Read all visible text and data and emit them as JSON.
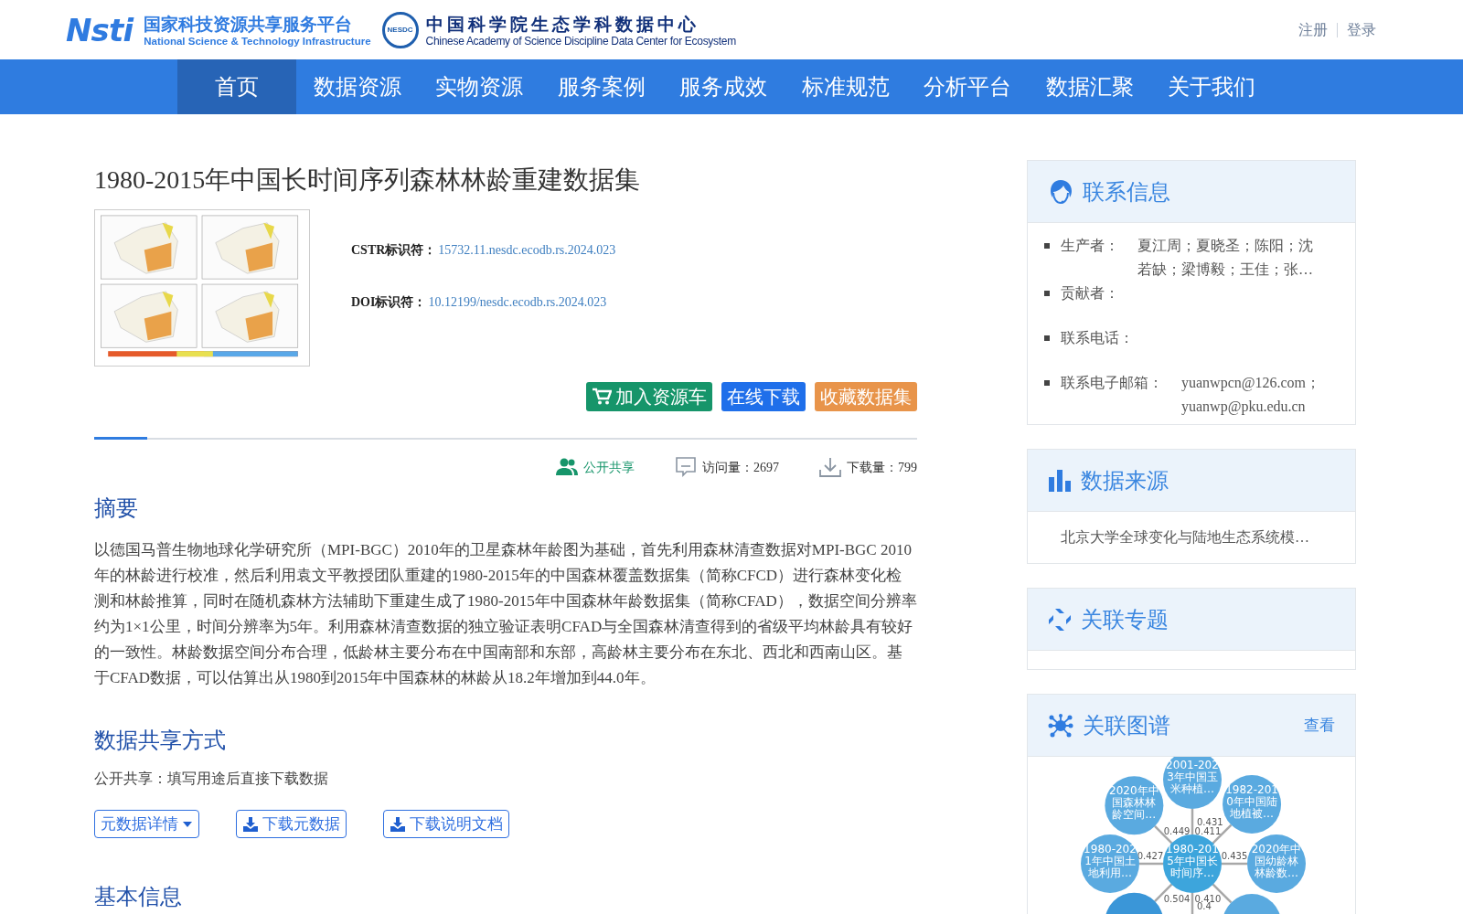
{
  "header": {
    "platform_mark": "Nsti",
    "platform_name": "国家科技资源共享服务平台",
    "platform_name_en": "National Science & Technology Infrastructure",
    "center_mark": "NESDC",
    "center_name": "中国科学院生态学科数据中心",
    "center_name_en": "Chinese Academy of Science Discipline Data Center for Ecosystem",
    "account_links": [
      "注册",
      "登录"
    ]
  },
  "nav": [
    {
      "label": "首页",
      "selected": true
    },
    {
      "label": "数据资源",
      "selected": false
    },
    {
      "label": "实物资源",
      "selected": false
    },
    {
      "label": "服务案例",
      "selected": false
    },
    {
      "label": "服务成效",
      "selected": false
    },
    {
      "label": "标准规范",
      "selected": false
    },
    {
      "label": "分析平台",
      "selected": false
    },
    {
      "label": "数据汇聚",
      "selected": false
    },
    {
      "label": "关于我们",
      "selected": false
    }
  ],
  "dataset": {
    "title": "1980-2015年中国长时间序列森林林龄重建数据集",
    "identifiers": [
      {
        "label": "CSTR标识符：",
        "value": "15732.11.nesdc.ecodb.rs.2024.023"
      },
      {
        "label": "DOI标识符：",
        "value": "10.12199/nesdc.ecodb.rs.2024.023"
      }
    ],
    "actions": [
      {
        "label": "加入资源车",
        "kind": "cart"
      },
      {
        "label": "在线下载",
        "kind": "download"
      },
      {
        "label": "收藏数据集",
        "kind": "favorite"
      }
    ],
    "stats": [
      {
        "kind": "share",
        "label": "公开共享"
      },
      {
        "kind": "visits",
        "label": "访问量：",
        "value": "2697"
      },
      {
        "kind": "downloads",
        "label": "下载量：",
        "value": "799"
      }
    ],
    "abstract": {
      "heading": "摘要",
      "text": "以德国马普生物地球化学研究所（MPI-BGC）2010年的卫星森林年龄图为基础，首先利用森林清查数据对MPI-BGC 2010年的林龄进行校准，然后利用袁文平教授团队重建的1980-2015年的中国森林覆盖数据集（简称CFCD）进行森林变化检测和林龄推算，同时在随机森林方法辅助下重建生成了1980-2015年中国森林年龄数据集（简称CFAD），数据空间分辨率约为1×1公里，时间分辨率为5年。利用森林清查数据的独立验证表明CFAD与全国森林清查得到的省级平均林龄具有较好的一致性。林龄数据空间分布合理，低龄林主要分布在中国南部和东部，高龄林主要分布在东北、西北和西南山区。基于CFAD数据，可以估算出从1980到2015年中国森林的林龄从18.2年增加到44.0年。"
    },
    "sharing": {
      "heading": "数据共享方式",
      "text": "公开共享：填写用途后直接下载数据",
      "buttons": [
        {
          "label": "元数据详情",
          "kind": "dropdown"
        },
        {
          "label": "下载元数据",
          "kind": "download"
        },
        {
          "label": "下载说明文档",
          "kind": "download"
        }
      ]
    },
    "next_heading": "基本信息"
  },
  "sidebar": {
    "contact": {
      "title": "联系信息",
      "items": [
        {
          "label": "生产者：",
          "values": [
            "夏江周；夏晓圣；陈阳；沈若缺；梁博毅；王佳；张…"
          ]
        },
        {
          "label": "贡献者："
        },
        {
          "label": "联系电话："
        },
        {
          "label": "联系电子邮箱：",
          "values": [
            "yuanwpcn@126.com；",
            "yuanwp@pku.edu.cn"
          ]
        }
      ]
    },
    "source": {
      "title": "数据来源",
      "text": "北京大学全球变化与陆地生态系统模…"
    },
    "topics": {
      "title": "关联专题"
    },
    "graph": {
      "title": "关联图谱",
      "link": "查看",
      "center": {
        "lines": [
          "1980-201",
          "5年中国长",
          "时间序…"
        ]
      },
      "nodes": [
        {
          "lines": [
            "2001-202",
            "3年中国玉",
            "米种植…"
          ],
          "weight": "0.431"
        },
        {
          "lines": [
            "2020年中",
            "国森林林",
            "龄空间…"
          ],
          "weight": "0.449"
        },
        {
          "lines": [
            "1982-201",
            "0年中国陆",
            "地植被…"
          ],
          "weight": "0.411"
        },
        {
          "lines": [
            "1980-202",
            "1年中国土",
            "地利用…"
          ],
          "weight": "0.427"
        },
        {
          "lines": [
            "2020年中",
            "国幼龄林",
            "林龄数…"
          ],
          "weight": "0.435"
        },
        {
          "weight": "0.504"
        },
        {
          "weight": "0.410"
        },
        {
          "weight": "0.4"
        }
      ]
    }
  }
}
